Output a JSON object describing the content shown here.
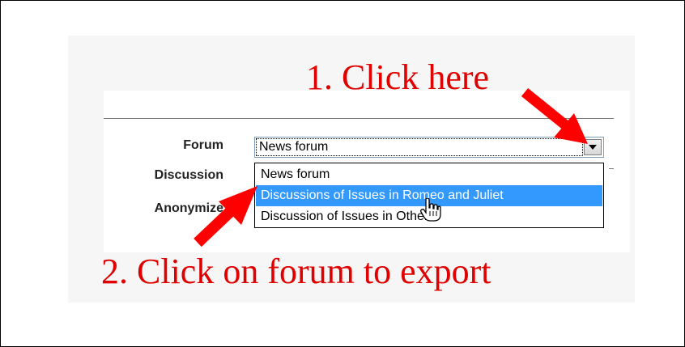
{
  "annotations": {
    "step1": "1. Click here",
    "step2": "2. Click on forum to export"
  },
  "form": {
    "forum_label": "Forum",
    "discussion_label": "Discussion",
    "anonymize_label": "Anonymize",
    "forum_select_value": "News forum",
    "options": [
      "News forum",
      "Discussions of Issues in Romeo and Juliet",
      "Discussion of Issues in Othello"
    ],
    "highlighted_option_index": 1
  },
  "colors": {
    "annotation": "#e00000",
    "highlight": "#3399ff",
    "arrow": "#ff0000"
  },
  "icons": [
    "chevron-down-icon",
    "hand-pointer-icon",
    "red-arrow-icon"
  ]
}
